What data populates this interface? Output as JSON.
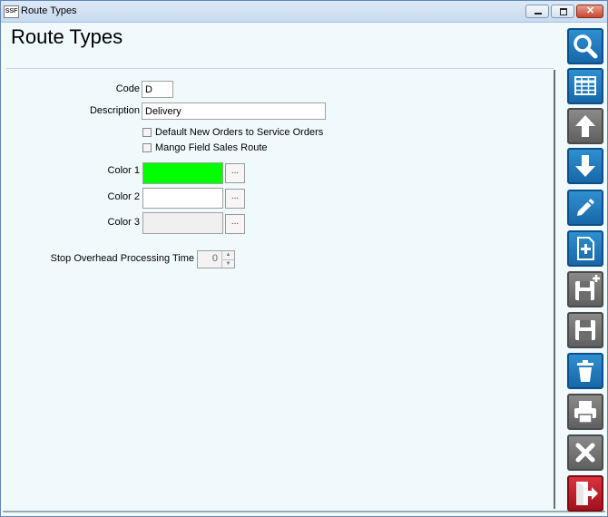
{
  "window": {
    "title": "Route Types",
    "app_icon_text": "SSF"
  },
  "page": {
    "title": "Route Types"
  },
  "form": {
    "code_label": "Code",
    "code_value": "D",
    "description_label": "Description",
    "description_value": "Delivery",
    "checkbox_service_orders": {
      "label": "Default New Orders to Service Orders",
      "checked": false
    },
    "checkbox_mango": {
      "label": "Mango Field Sales Route",
      "checked": false
    },
    "color1_label": "Color 1",
    "color1_value": "#00ff00",
    "color2_label": "Color 2",
    "color2_value": "#ffffff",
    "color3_label": "Color 3",
    "color3_value": "#f0f0f0",
    "browse_label": "...",
    "stop_overhead_label": "Stop Overhead Processing Time",
    "stop_overhead_value": "0"
  },
  "toolbar": [
    {
      "name": "search",
      "icon": "search-icon",
      "style": "blue"
    },
    {
      "name": "grid",
      "icon": "grid-icon",
      "style": "blue"
    },
    {
      "name": "up",
      "icon": "arrow-up-icon",
      "style": "gray"
    },
    {
      "name": "down",
      "icon": "arrow-down-icon",
      "style": "blue"
    },
    {
      "name": "edit",
      "icon": "pencil-icon",
      "style": "blue"
    },
    {
      "name": "new",
      "icon": "new-document-icon",
      "style": "blue"
    },
    {
      "name": "save-new",
      "icon": "save-plus-icon",
      "style": "gray"
    },
    {
      "name": "save",
      "icon": "save-icon",
      "style": "gray"
    },
    {
      "name": "delete",
      "icon": "trash-icon",
      "style": "blue"
    },
    {
      "name": "print",
      "icon": "printer-icon",
      "style": "gray"
    },
    {
      "name": "cancel",
      "icon": "close-x-icon",
      "style": "gray"
    },
    {
      "name": "exit",
      "icon": "exit-door-icon",
      "style": "red"
    }
  ]
}
